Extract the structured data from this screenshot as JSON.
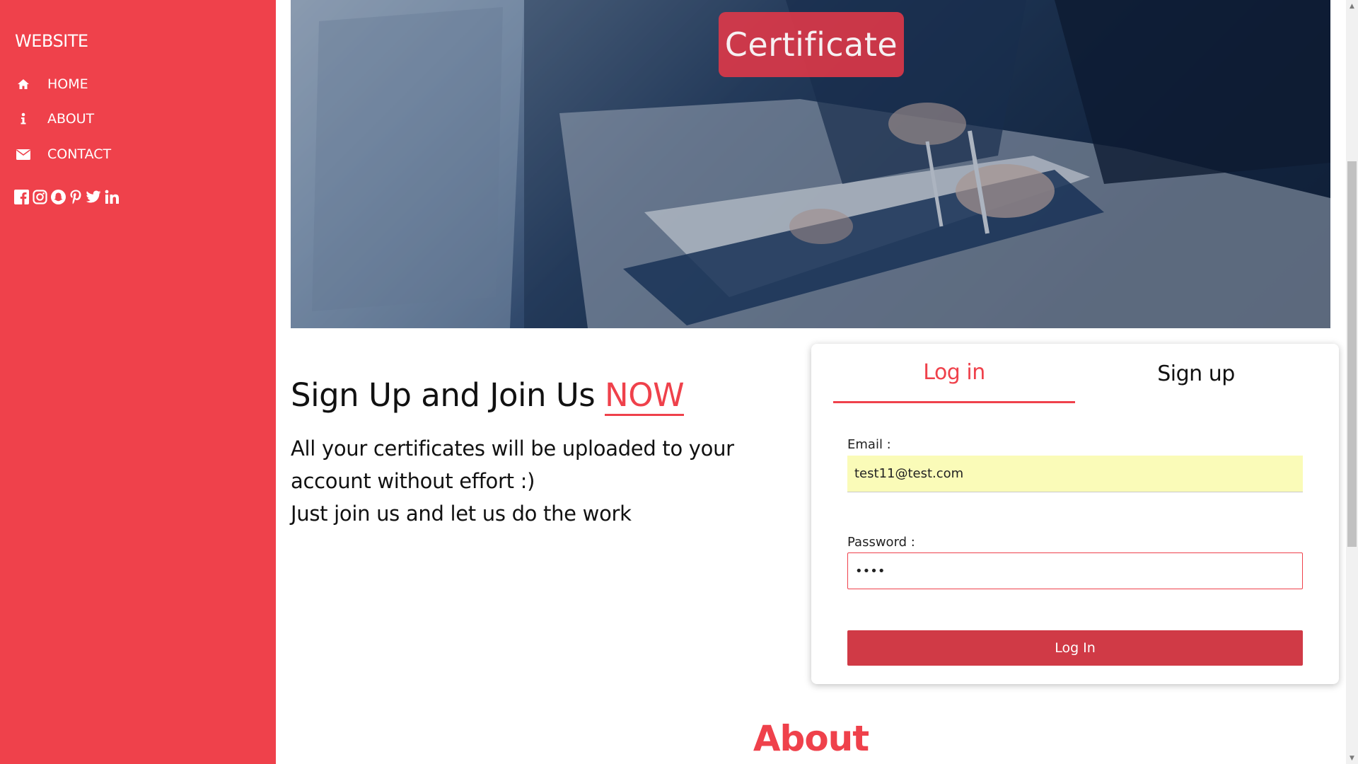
{
  "sidebar": {
    "brand": "WEBSITE",
    "nav": [
      {
        "label": "HOME",
        "icon": "home-icon"
      },
      {
        "label": "ABOUT",
        "icon": "info-icon"
      },
      {
        "label": "CONTACT",
        "icon": "envelope-icon"
      }
    ],
    "social": [
      "facebook-icon",
      "instagram-icon",
      "snapchat-icon",
      "pinterest-icon",
      "twitter-icon",
      "linkedin-icon"
    ],
    "background_color": "#ef414b"
  },
  "hero": {
    "badge_text": "Certificate",
    "badge_color": "#e23848"
  },
  "intro": {
    "heading_prefix": "Sign Up and Join Us ",
    "heading_highlight": "NOW",
    "lines": [
      "All your certificates will be uploaded to your",
      "account without effort :)",
      "Just join us and let us do the work"
    ]
  },
  "auth_card": {
    "tabs": [
      {
        "label": "Log in",
        "active": true
      },
      {
        "label": "Sign up",
        "active": false
      }
    ],
    "email_label": "Email :",
    "email_value": "test11@test.com",
    "password_label": "Password :",
    "password_value": "••••",
    "submit_label": "Log In"
  },
  "about": {
    "title": "About"
  },
  "colors": {
    "accent": "#ef414b",
    "button": "#d03a46",
    "autofill": "#fafbb8"
  }
}
